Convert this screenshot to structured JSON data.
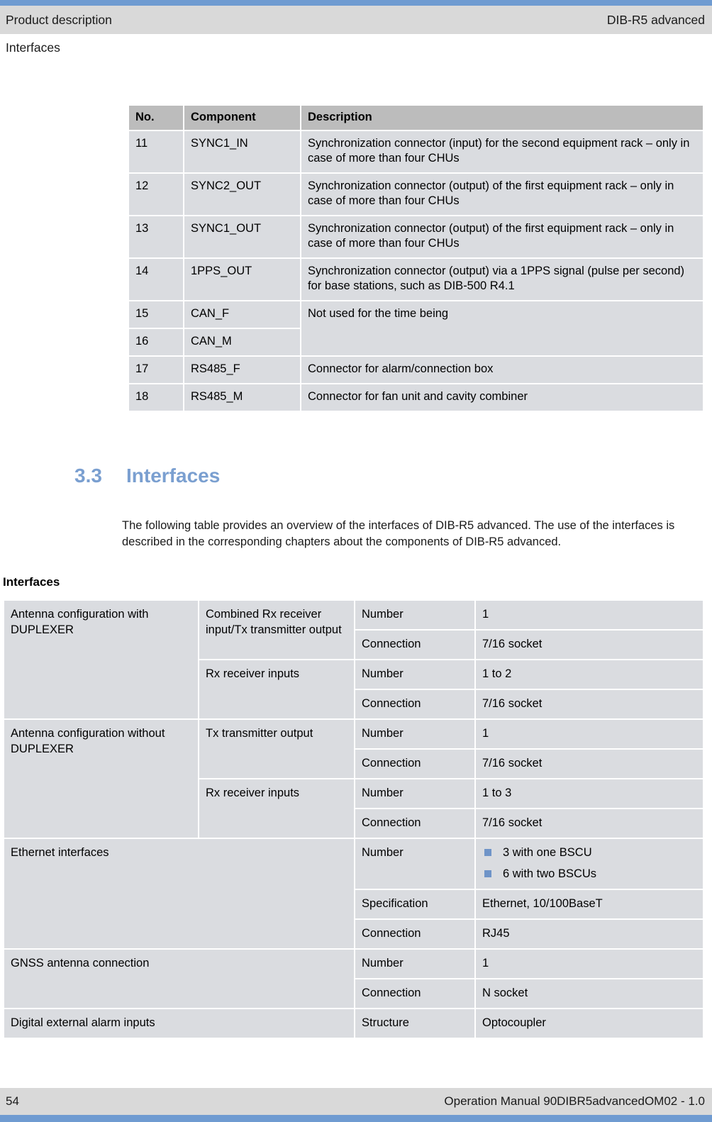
{
  "colors": {
    "rule_blue": "#6f9bd1",
    "heading_blue": "#7a9fd0",
    "bullet_blue": "#6f94c8",
    "band_gray": "#d9d9d9",
    "table_header_gray": "#bcbcbc",
    "table_cell_gray": "#dadce0"
  },
  "header": {
    "left": "Product description",
    "right": "DIB-R5 advanced",
    "subtitle": "Interfaces"
  },
  "components_table": {
    "columns": [
      "No.",
      "Component",
      "Description"
    ],
    "rows": [
      {
        "no": "11",
        "component": "SYNC1_IN",
        "description": "Synchronization connector (input) for the second equipment rack – only in case of more than four CHUs"
      },
      {
        "no": "12",
        "component": "SYNC2_OUT",
        "description": "Synchronization connector (output) of the first equipment rack – only in case of more than four CHUs"
      },
      {
        "no": "13",
        "component": "SYNC1_OUT",
        "description": "Synchronization connector (output) of the first equipment rack – only in case of more than four CHUs"
      },
      {
        "no": "14",
        "component": "1PPS_OUT",
        "description": "Synchronization connector (output) via a 1PPS signal (pulse per second) for base stations, such as DIB-500 R4.1"
      },
      {
        "no": "15",
        "component": "CAN_F",
        "description": "Not used for the time being"
      },
      {
        "no": "16",
        "component": "CAN_M",
        "description": ""
      },
      {
        "no": "17",
        "component": "RS485_F",
        "description": "Connector for alarm/connection box"
      },
      {
        "no": "18",
        "component": "RS485_M",
        "description": "Connector for fan unit and cavity combiner"
      }
    ]
  },
  "section": {
    "number": "3.3",
    "title": "Interfaces",
    "body": "The following table provides an overview of the interfaces of DIB-R5 advanced. The use of the interfaces is described in the corresponding chapters about the components of DIB-R5 advanced."
  },
  "interfaces_table": {
    "caption": "Interfaces",
    "groups": {
      "antenna_with_duplexer": "Antenna configuration with DUPLEXER",
      "antenna_without_duplexer": "Antenna configuration without DUPLEXER",
      "ethernet": "Ethernet interfaces",
      "gnss": "GNSS antenna connection",
      "digital_alarm": "Digital external alarm inputs"
    },
    "subgroups": {
      "combined_rx_tx": "Combined Rx receiver input/Tx transmitter output",
      "rx_inputs_1": "Rx receiver inputs",
      "tx_output": "Tx transmitter output",
      "rx_inputs_2": "Rx receiver inputs"
    },
    "labels": {
      "number": "Number",
      "connection": "Connection",
      "specification": "Specification",
      "structure": "Structure"
    },
    "values": {
      "combined_number": "1",
      "combined_connection": "7/16 socket",
      "rx1_number": "1 to 2",
      "rx1_connection": "7/16 socket",
      "tx_number": "1",
      "tx_connection": "7/16 socket",
      "rx2_number": "1 to 3",
      "rx2_connection": "7/16 socket",
      "ethernet_number_bullets": [
        "3 with one BSCU",
        "6 with two BSCUs"
      ],
      "ethernet_specification": "Ethernet, 10/100BaseT",
      "ethernet_connection": "RJ45",
      "gnss_number": "1",
      "gnss_connection": "N socket",
      "digital_structure": "Optocoupler"
    }
  },
  "footer": {
    "page_number": "54",
    "manual": "Operation Manual 90DIBR5advancedOM02 - 1.0"
  }
}
